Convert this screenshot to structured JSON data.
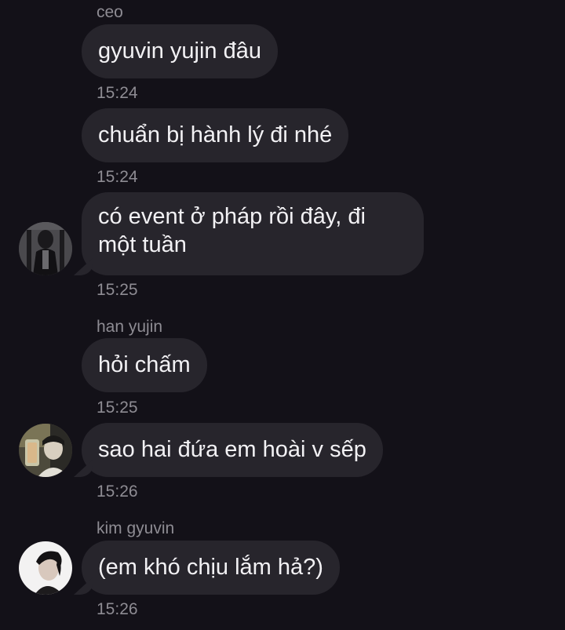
{
  "senders": {
    "first": "ceo",
    "second": "han yujin",
    "third": "kim gyuvin"
  },
  "messages": [
    {
      "text": "gyuvin yujin đâu",
      "time": "15:24"
    },
    {
      "text": "chuẩn bị hành lý đi nhé",
      "time": "15:24"
    },
    {
      "text": "có event ở pháp rồi đây, đi một tuần",
      "time": "15:25"
    },
    {
      "text": "hỏi chấm",
      "time": "15:25"
    },
    {
      "text": "sao hai đứa em hoài v sếp",
      "time": "15:26"
    },
    {
      "text": "(em khó chịu lắm hả?)",
      "time": "15:26"
    }
  ],
  "avatars": [
    "ceo-avatar",
    "han-yujin-avatar",
    "kim-gyuvin-avatar"
  ],
  "colors": {
    "background": "#131118",
    "bubble": "#27252c",
    "text": "#f2f1f4",
    "meta": "#8e8c93"
  }
}
